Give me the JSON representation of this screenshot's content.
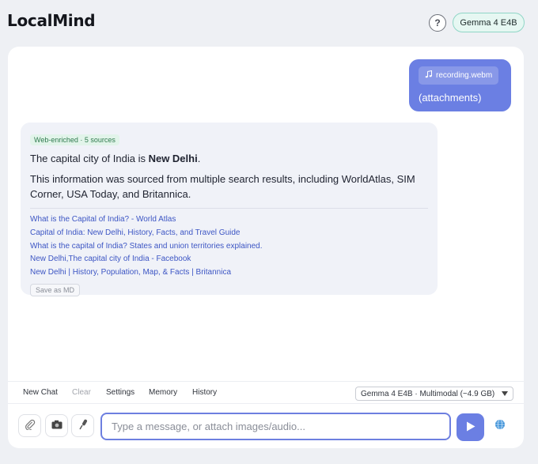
{
  "header": {
    "title": "LocalMind",
    "help_label": "?",
    "model_pill": "Gemma 4 E4B"
  },
  "chat": {
    "user_message": {
      "attachment_name": "recording.webm",
      "attachment_icon": "music-note-icon",
      "text": "(attachments)"
    },
    "bot_message": {
      "badge": "Web-enriched · 5 sources",
      "answer_prefix": "The capital city of India is ",
      "answer_bold": "New Delhi",
      "answer_suffix": ".",
      "paragraph": "This information was sourced from multiple search results, including WorldAtlas, SIM Corner, USA Today, and Britannica.",
      "sources": [
        "What is the Capital of India? - World Atlas",
        "Capital of India: New Delhi, History, Facts, and Travel Guide",
        "What is the capital of India? States and union territories explained.",
        "New Delhi,The capital city of India - Facebook",
        "New Delhi | History, Population, Map, & Facts | Britannica"
      ],
      "save_label": "Save as MD"
    }
  },
  "toolbar": {
    "new_chat": "New Chat",
    "clear": "Clear",
    "settings": "Settings",
    "memory": "Memory",
    "history": "History",
    "model_select": "Gemma 4 E4B · Multimodal (~4.9 GB)"
  },
  "composer": {
    "placeholder": "Type a message, or attach images/audio...",
    "value": "",
    "icons": [
      "paperclip-icon",
      "camera-icon",
      "microphone-icon",
      "send-icon",
      "globe-icon"
    ]
  },
  "colors": {
    "accent": "#6b7fe3",
    "link": "#3d56c4",
    "badge_bg": "#e2f4ea",
    "badge_text": "#2f7a4e",
    "pill_border": "#8fd6c6"
  }
}
